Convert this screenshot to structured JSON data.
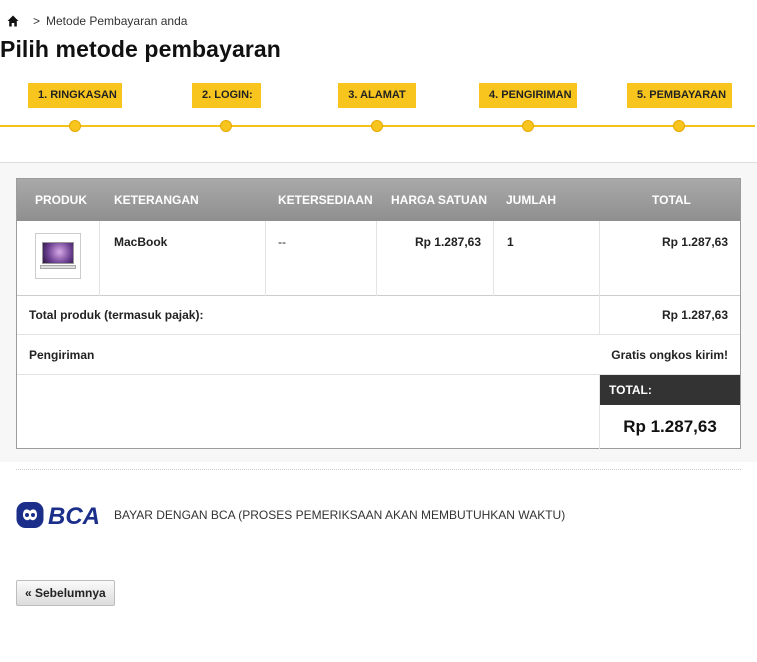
{
  "breadcrumb": {
    "separator": ">",
    "current": "Metode Pembayaran anda"
  },
  "page_title": "Pilih metode pembayaran",
  "steps": [
    {
      "label": "1. RINGKASAN"
    },
    {
      "label": "2. LOGIN:"
    },
    {
      "label": "3. ALAMAT"
    },
    {
      "label": "4. PENGIRIMAN"
    },
    {
      "label": "5. PEMBAYARAN"
    }
  ],
  "cart": {
    "headers": {
      "product": "PRODUK",
      "description": "KETERANGAN",
      "availability": "KETERSEDIAAN",
      "unit_price": "HARGA SATUAN",
      "quantity": "JUMLAH",
      "total": "TOTAL"
    },
    "items": [
      {
        "description": "MacBook",
        "availability": "--",
        "unit_price": "Rp 1.287,63",
        "quantity": "1",
        "total": "Rp 1.287,63"
      }
    ],
    "total_products_label": "Total produk (termasuk pajak):",
    "total_products_value": "Rp 1.287,63",
    "shipping_label": "Pengiriman",
    "shipping_value": "Gratis ongkos kirim!",
    "grand_total_label": "TOTAL:",
    "grand_total_value": "Rp 1.287,63"
  },
  "payment": {
    "bca_logo_text": "BCA",
    "bca_label": "BAYAR DENGAN BCA (PROSES PEMERIKSAAN AKAN MEMBUTUHKAN WAKTU)"
  },
  "prev_button": "« Sebelumnya",
  "colors": {
    "step_yellow": "#f7c51e",
    "table_header": "#9c9c9c",
    "bca_blue": "#1b2f8a"
  }
}
